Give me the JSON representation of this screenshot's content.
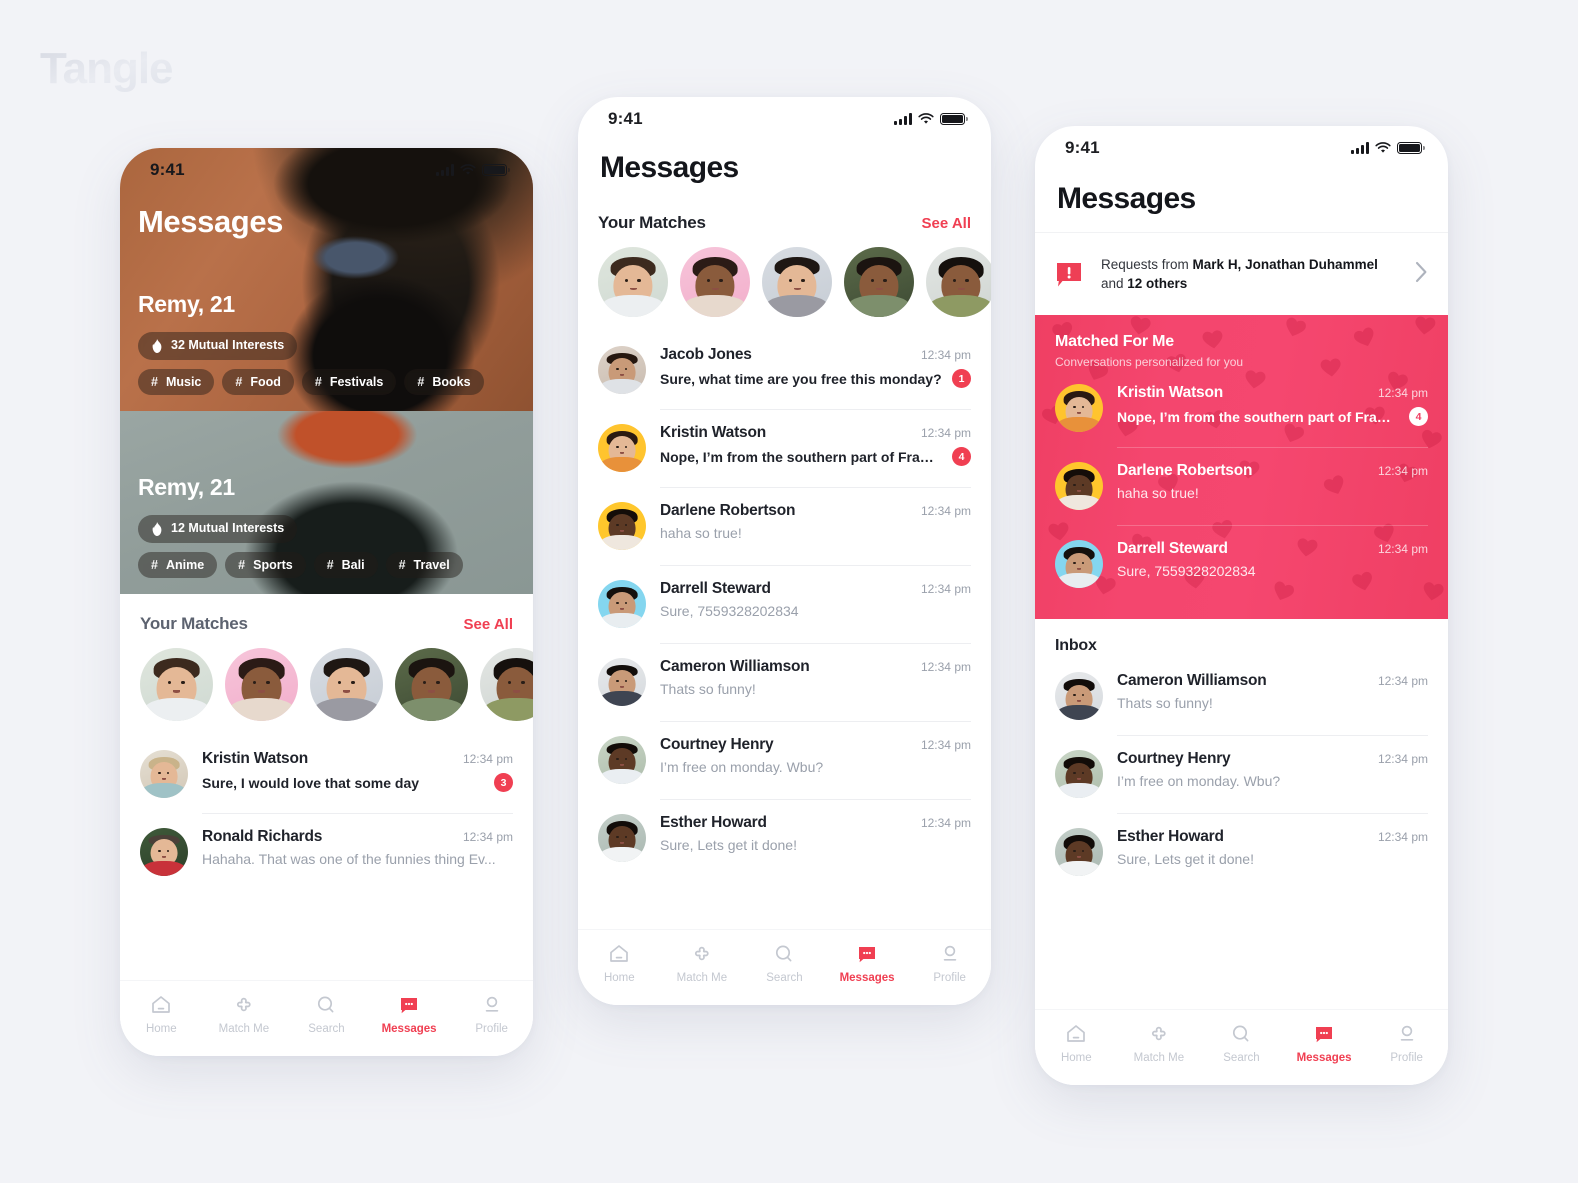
{
  "brand": {
    "name": "Tangle"
  },
  "status_bar": {
    "time": "9:41",
    "signal_icon": "cellular-bars-icon",
    "wifi_icon": "wifi-icon",
    "battery_icon": "battery-icon"
  },
  "nav": {
    "items": [
      {
        "label": "Home",
        "icon": "home-icon",
        "active": false
      },
      {
        "label": "Match Me",
        "icon": "puzzle-piece-icon",
        "active": false
      },
      {
        "label": "Search",
        "icon": "search-icon",
        "active": false
      },
      {
        "label": "Messages",
        "icon": "message-bubble-icon",
        "active": true
      },
      {
        "label": "Profile",
        "icon": "profile-person-icon",
        "active": false
      }
    ]
  },
  "colors": {
    "accent_red": "#f03f52",
    "matched_pink": "#f4466e",
    "page_background": "#f2f3f7",
    "text_primary": "#1f222a",
    "text_muted": "#9aa0ab"
  },
  "screen1": {
    "title": "Messages",
    "cards": [
      {
        "name": "Remy, 21",
        "mutual": "32 Mutual Interests",
        "mutual_icon": "flame-icon",
        "tags": [
          "Music",
          "Food",
          "Festivals",
          "Books"
        ]
      },
      {
        "name": "Remy, 21",
        "mutual": "12 Mutual Interests",
        "mutual_icon": "flame-icon",
        "tags": [
          "Anime",
          "Sports",
          "Bali",
          "Travel"
        ]
      }
    ],
    "matches": {
      "title": "Your Matches",
      "see_all": "See All",
      "count": 5
    },
    "conversations": [
      {
        "name": "Kristin Watson",
        "message": "Sure, I would love that some day",
        "time": "12:34 pm",
        "badge": "3",
        "unread": true
      },
      {
        "name": "Ronald Richards",
        "message": "Hahaha. That was one of the funnies thing Ev...",
        "time": "12:34 pm",
        "badge": "",
        "unread": false
      }
    ]
  },
  "screen2": {
    "title": "Messages",
    "matches": {
      "title": "Your Matches",
      "see_all": "See All",
      "count": 5
    },
    "conversations": [
      {
        "name": "Jacob Jones",
        "message": "Sure, what time are you free this monday?",
        "time": "12:34 pm",
        "badge": "1",
        "unread": true
      },
      {
        "name": "Kristin Watson",
        "message": "Nope, I’m from the southern part of France...",
        "time": "12:34 pm",
        "badge": "4",
        "unread": true
      },
      {
        "name": "Darlene Robertson",
        "message": "haha so true!",
        "time": "12:34 pm",
        "badge": "",
        "unread": false
      },
      {
        "name": "Darrell Steward",
        "message": "Sure, 7559328202834",
        "time": "12:34 pm",
        "badge": "",
        "unread": false
      },
      {
        "name": "Cameron Williamson",
        "message": "Thats so funny!",
        "time": "12:34 pm",
        "badge": "",
        "unread": false
      },
      {
        "name": "Courtney Henry",
        "message": "I’m free on monday. Wbu?",
        "time": "12:34 pm",
        "badge": "",
        "unread": false
      },
      {
        "name": "Esther Howard",
        "message": "Sure, Lets get it done!",
        "time": "12:34 pm",
        "badge": "",
        "unread": false
      }
    ]
  },
  "screen3": {
    "title": "Messages",
    "requests": {
      "icon": "alert-message-icon",
      "prefix": "Requests from ",
      "names": "Mark H, Jonathan Duhammel",
      "middle": " and ",
      "others": "12 others",
      "chevron_icon": "chevron-right-icon"
    },
    "matched": {
      "title": "Matched For Me",
      "subtitle": "Conversations personalized for you",
      "conversations": [
        {
          "name": "Kristin Watson",
          "message": "Nope, I’m from the southern part of France...",
          "time": "12:34 pm",
          "badge": "4",
          "unread": true
        },
        {
          "name": "Darlene Robertson",
          "message": "haha so true!",
          "time": "12:34 pm",
          "badge": "",
          "unread": false
        },
        {
          "name": "Darrell Steward",
          "message": "Sure, 7559328202834",
          "time": "12:34 pm",
          "badge": "",
          "unread": false
        }
      ]
    },
    "inbox": {
      "title": "Inbox",
      "conversations": [
        {
          "name": "Cameron Williamson",
          "message": "Thats so funny!",
          "time": "12:34 pm",
          "badge": "",
          "unread": false
        },
        {
          "name": "Courtney Henry",
          "message": "I’m free on monday. Wbu?",
          "time": "12:34 pm",
          "badge": "",
          "unread": false
        },
        {
          "name": "Esther Howard",
          "message": "Sure, Lets get it done!",
          "time": "12:34 pm",
          "badge": "",
          "unread": false
        }
      ]
    }
  }
}
